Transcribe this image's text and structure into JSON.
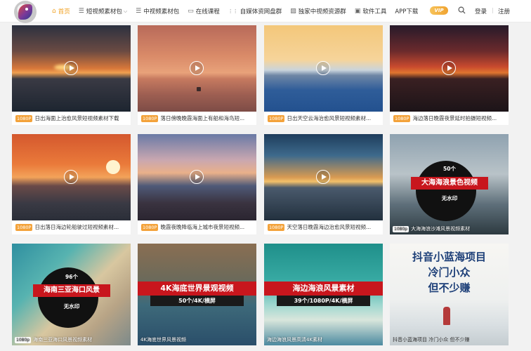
{
  "header": {
    "nav": [
      {
        "icon": "home-icon",
        "glyph": "⌂",
        "label": "首页",
        "active": true
      },
      {
        "icon": "list-icon",
        "glyph": "☰",
        "label": "短视频素材包",
        "dropdown": "⌵"
      },
      {
        "icon": "list-icon",
        "glyph": "☰",
        "label": "中视频素材包"
      },
      {
        "icon": "tv-icon",
        "glyph": "▭",
        "label": "在线课程"
      },
      {
        "icon": "grid-icon",
        "glyph": "⋮⋮",
        "label": "自媒体资网盘群"
      },
      {
        "icon": "image-icon",
        "glyph": "▨",
        "label": "独家中视频资源群"
      },
      {
        "icon": "briefcase-icon",
        "glyph": "▣",
        "label": "软件工具"
      },
      {
        "icon": "",
        "glyph": "",
        "label": "APP下载"
      }
    ],
    "vip_label": "VIP",
    "login_label": "登录",
    "separator": "|",
    "register_label": "注册"
  },
  "cards": [
    {
      "tag": "1080P",
      "title": "日出海面上治愈风景短视频素材下载"
    },
    {
      "tag": "1080P",
      "title": "落日傍晚晚霞海面上有船和海鸟短..."
    },
    {
      "tag": "1080P",
      "title": "日出天空云海治愈风景短视频素材..."
    },
    {
      "tag": "1080P",
      "title": "海边落日晚霞夜景延时拍摄短视频..."
    },
    {
      "tag": "1080P",
      "title": "日出落日海边轮船驶过短视频素材..."
    },
    {
      "tag": "1080P",
      "title": "晚霞夜晚降临海上城市夜景短视频..."
    },
    {
      "tag": "1080P",
      "title": "天空落日晚霞海边治愈风景短视频..."
    },
    {
      "tag": "1080p",
      "title": "大海海浪沙滩风景视频素材",
      "overlay": true,
      "ad": {
        "count": "50个",
        "banner": "大海海浪景色视频",
        "note": "无水印"
      }
    },
    {
      "tag": "1080p",
      "title": "海南三亚海口风景视频素材",
      "overlay": true,
      "ad": {
        "count": "96个",
        "banner": "海南三亚海口风景",
        "note": "无水印"
      }
    },
    {
      "tag": "",
      "title": "4K海底世界风景视频",
      "overlay": true,
      "ad": {
        "banner": "4K海底世界景观视频",
        "sub": "50个/4K/横屏"
      }
    },
    {
      "tag": "",
      "title": "海边海浪风景高清4K素材",
      "overlay": true,
      "ad": {
        "banner": "海边海浪风景素材",
        "sub": "39个/1080P/4K/横屏"
      }
    },
    {
      "tag": "",
      "title": "抖音小蓝海项目 冷门小众 但不少赚",
      "overlay": true,
      "ad": {
        "line1": "抖音小蓝海项目",
        "line2": "冷门小众",
        "line3": "但不少赚"
      }
    }
  ]
}
